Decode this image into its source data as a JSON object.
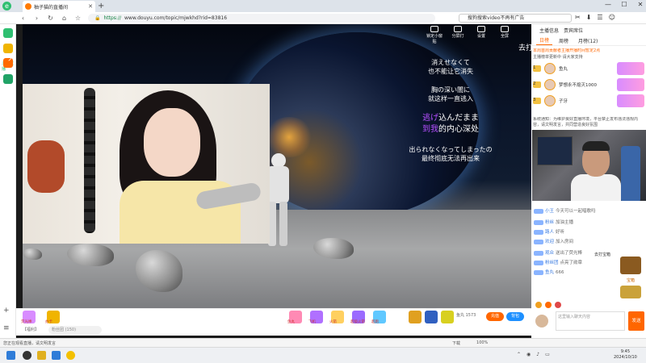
{
  "browser": {
    "tab_title": "柚子猫的直播间",
    "url_scheme": "https://",
    "url_rest": "www.douyu.com/topic/mjwkhd?rid=83816",
    "search_text": "搜狗搜索video不再有广告",
    "nav": {
      "back": "‹",
      "forward": "›",
      "reload": "↻",
      "home": "⌂",
      "star": "☆"
    },
    "window_controls": [
      "—",
      "☐",
      "✕"
    ]
  },
  "sidebar": {
    "label": "斗鱼直播"
  },
  "video": {
    "lyrics": [
      {
        "text": "消えせなくて",
        "style": "normal"
      },
      {
        "text": "也不能让它消失",
        "style": "normal"
      },
      {
        "text": "",
        "style": "gap"
      },
      {
        "text": "胸の深い闇に",
        "style": "normal"
      },
      {
        "text": "就这样一直逃入",
        "style": "normal"
      },
      {
        "text": "",
        "style": "gap"
      }
    ],
    "lyric_hl_1a": "逃げ",
    "lyric_hl_1b": "込んだまま",
    "lyric_hl_2a": "到我",
    "lyric_hl_2b": "的内心深处",
    "lyric_tail": [
      "出られなくなってしまったの",
      "最终彻底无法再出来"
    ],
    "tools": [
      "锁定小窗贴",
      "分屏打",
      "设置",
      "全屏"
    ],
    "edge_text_left": "人",
    "edge_text_right": "去打"
  },
  "right_panel": {
    "top_tabs": [
      "主播信息",
      "贵宾席位"
    ],
    "tabs": [
      "日榜",
      "周榜",
      "月榜(12)"
    ],
    "notice": "本周首周贡献者主播开播时间暂定2点",
    "notice2": "主播榜单更新中 请大家支持",
    "ranks": [
      {
        "name": "鱼丸",
        "num": "1"
      },
      {
        "name": "梦想永不熄灭1000",
        "num": "2"
      },
      {
        "name": "子牙",
        "num": "3"
      }
    ],
    "message": "系统通知：为维护良好直播环境，平台禁止发布违法违规内容，请文明发言，共同营造良好氛围",
    "chat": [
      {
        "lv": "",
        "name": "小王",
        "text": "今天可以一起唱歌吗"
      },
      {
        "lv": "",
        "name": "粉丝",
        "text": "加油主播"
      },
      {
        "lv": "",
        "name": "路人",
        "text": "好听"
      },
      {
        "lv": "",
        "name": "欢迎",
        "text": "加入房间"
      },
      {
        "lv": "",
        "name": "观众",
        "text": "送出了荧光棒"
      },
      {
        "lv": "",
        "name": "粉丝团",
        "text": "点亮了勋章"
      },
      {
        "lv": "",
        "name": "鱼丸",
        "text": "666"
      }
    ],
    "treasure_title": "去打宝箱",
    "treasure_label": "宝箱",
    "chat_placeholder": "这里输入聊天内容",
    "send_label": "发送"
  },
  "gift_bar": {
    "gifts": [
      "荧光棒",
      "办卡",
      "鱼丸",
      "飞机",
      "火箭",
      "超级火箭",
      "超跑",
      "宝藏"
    ],
    "count": "鱼丸 1573",
    "recharge": "充值",
    "send": "背包"
  },
  "bottom_row": {
    "label": "【福利】",
    "value": "粉丝团 (150)"
  },
  "statusbar": {
    "left": "您正在观看直播，请文明发言",
    "right": [
      "下载",
      "100%"
    ]
  },
  "clock": {
    "time": "9:45",
    "date": "2024/10/10"
  }
}
